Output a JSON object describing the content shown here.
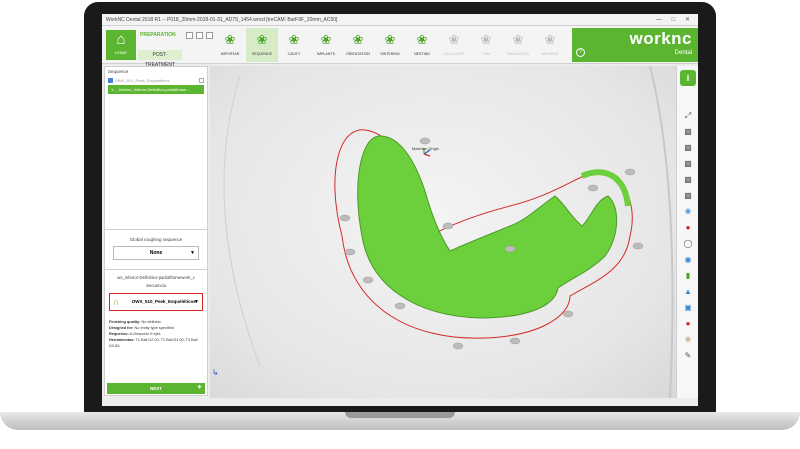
{
  "titlebar": {
    "title": "WorkNC Dental 2018 R1 -- P018_20mm-2018-01-31_AD79_1454.wncd [treCAM: BarF9F_20mm_AC50]"
  },
  "ribbon": {
    "home_label": "HOME",
    "section_label": "PREPARATION",
    "subsection_label": "POST-TREATMENT",
    "tools": [
      {
        "label": "IMPORTAR",
        "icon": "tooth-import-icon",
        "state": "normal"
      },
      {
        "label": "SEQUENCE",
        "icon": "tooth-sequence-icon",
        "state": "active"
      },
      {
        "label": "CAVITY",
        "icon": "tooth-cavity-icon",
        "state": "normal"
      },
      {
        "label": "IMPLANTS",
        "icon": "implant-icon",
        "state": "normal"
      },
      {
        "label": "ORIENTATION",
        "icon": "orientation-icon",
        "state": "normal"
      },
      {
        "label": "SINTERING",
        "icon": "sintering-icon",
        "state": "normal"
      },
      {
        "label": "NESTING",
        "icon": "nesting-icon",
        "state": "normal"
      },
      {
        "label": "CALCULATE",
        "icon": "calculate-icon",
        "state": "disabled"
      },
      {
        "label": "CAM",
        "icon": "cam-icon",
        "state": "disabled"
      },
      {
        "label": "SIMULATION",
        "icon": "simulation-icon",
        "state": "disabled"
      },
      {
        "label": "MACHINE",
        "icon": "machine-icon",
        "state": "disabled"
      }
    ],
    "brand_word": "worknc",
    "brand_sub": "Dental"
  },
  "left_panel": {
    "sequence_title": "Sequence",
    "sequence_row": "DWX_510_Peek_Esqueléticos",
    "sequence_item": "1 - _Inferior_Inferior-Definitivo-partialframe...",
    "global_roughing_label": "Global roughing sequence",
    "global_roughing_value": "None",
    "part_name": "wo_inferior-Definitivo-partialframework_c",
    "secuencia_label": "Secuencia",
    "secuencia_value": "DWX_510_Peek_Esqueléticos",
    "info": [
      {
        "key": "Finishing quality:",
        "value": "No definido"
      },
      {
        "key": "Designed for:",
        "value": "No entity type specified"
      },
      {
        "key": "Requeriso:",
        "value": "A-Desución 5 ejes"
      },
      {
        "key": "Herramientas:",
        "value": "T1 Ball D2.00; T2 Ball D1.00; T3 Ball D0.60;"
      }
    ],
    "next_label": "NEXT"
  },
  "viewport": {
    "machine_origin_label": "Machine Origin",
    "model_color": "#6ccf3c",
    "outline_color": "#d42a2a"
  },
  "right_toolbar": {
    "info_label": "i",
    "icons": [
      "fit-view-icon",
      "iso-view-icon",
      "front-view-icon",
      "top-view-icon",
      "side-view-icon",
      "back-view-icon",
      "tooth-view-icon",
      "tooth-red-icon",
      "ring-icon",
      "blue-circle-icon",
      "cylinder-icon",
      "probe-icon",
      "cad-icon",
      "alert-icon",
      "tooth-beige-icon",
      "edit-icon"
    ]
  }
}
